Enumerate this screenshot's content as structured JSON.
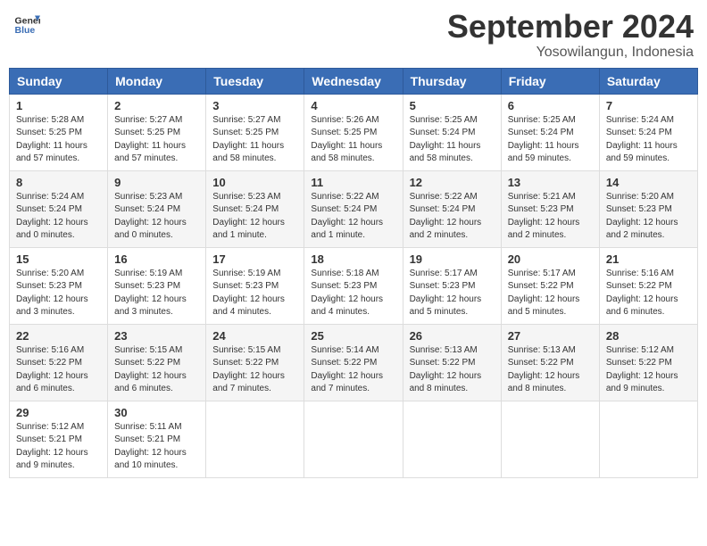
{
  "header": {
    "logo_line1": "General",
    "logo_line2": "Blue",
    "month": "September 2024",
    "location": "Yosowilangun, Indonesia"
  },
  "weekdays": [
    "Sunday",
    "Monday",
    "Tuesday",
    "Wednesday",
    "Thursday",
    "Friday",
    "Saturday"
  ],
  "weeks": [
    [
      {
        "day": "1",
        "info": "Sunrise: 5:28 AM\nSunset: 5:25 PM\nDaylight: 11 hours\nand 57 minutes."
      },
      {
        "day": "2",
        "info": "Sunrise: 5:27 AM\nSunset: 5:25 PM\nDaylight: 11 hours\nand 57 minutes."
      },
      {
        "day": "3",
        "info": "Sunrise: 5:27 AM\nSunset: 5:25 PM\nDaylight: 11 hours\nand 58 minutes."
      },
      {
        "day": "4",
        "info": "Sunrise: 5:26 AM\nSunset: 5:25 PM\nDaylight: 11 hours\nand 58 minutes."
      },
      {
        "day": "5",
        "info": "Sunrise: 5:25 AM\nSunset: 5:24 PM\nDaylight: 11 hours\nand 58 minutes."
      },
      {
        "day": "6",
        "info": "Sunrise: 5:25 AM\nSunset: 5:24 PM\nDaylight: 11 hours\nand 59 minutes."
      },
      {
        "day": "7",
        "info": "Sunrise: 5:24 AM\nSunset: 5:24 PM\nDaylight: 11 hours\nand 59 minutes."
      }
    ],
    [
      {
        "day": "8",
        "info": "Sunrise: 5:24 AM\nSunset: 5:24 PM\nDaylight: 12 hours\nand 0 minutes."
      },
      {
        "day": "9",
        "info": "Sunrise: 5:23 AM\nSunset: 5:24 PM\nDaylight: 12 hours\nand 0 minutes."
      },
      {
        "day": "10",
        "info": "Sunrise: 5:23 AM\nSunset: 5:24 PM\nDaylight: 12 hours\nand 1 minute."
      },
      {
        "day": "11",
        "info": "Sunrise: 5:22 AM\nSunset: 5:24 PM\nDaylight: 12 hours\nand 1 minute."
      },
      {
        "day": "12",
        "info": "Sunrise: 5:22 AM\nSunset: 5:24 PM\nDaylight: 12 hours\nand 2 minutes."
      },
      {
        "day": "13",
        "info": "Sunrise: 5:21 AM\nSunset: 5:23 PM\nDaylight: 12 hours\nand 2 minutes."
      },
      {
        "day": "14",
        "info": "Sunrise: 5:20 AM\nSunset: 5:23 PM\nDaylight: 12 hours\nand 2 minutes."
      }
    ],
    [
      {
        "day": "15",
        "info": "Sunrise: 5:20 AM\nSunset: 5:23 PM\nDaylight: 12 hours\nand 3 minutes."
      },
      {
        "day": "16",
        "info": "Sunrise: 5:19 AM\nSunset: 5:23 PM\nDaylight: 12 hours\nand 3 minutes."
      },
      {
        "day": "17",
        "info": "Sunrise: 5:19 AM\nSunset: 5:23 PM\nDaylight: 12 hours\nand 4 minutes."
      },
      {
        "day": "18",
        "info": "Sunrise: 5:18 AM\nSunset: 5:23 PM\nDaylight: 12 hours\nand 4 minutes."
      },
      {
        "day": "19",
        "info": "Sunrise: 5:17 AM\nSunset: 5:23 PM\nDaylight: 12 hours\nand 5 minutes."
      },
      {
        "day": "20",
        "info": "Sunrise: 5:17 AM\nSunset: 5:22 PM\nDaylight: 12 hours\nand 5 minutes."
      },
      {
        "day": "21",
        "info": "Sunrise: 5:16 AM\nSunset: 5:22 PM\nDaylight: 12 hours\nand 6 minutes."
      }
    ],
    [
      {
        "day": "22",
        "info": "Sunrise: 5:16 AM\nSunset: 5:22 PM\nDaylight: 12 hours\nand 6 minutes."
      },
      {
        "day": "23",
        "info": "Sunrise: 5:15 AM\nSunset: 5:22 PM\nDaylight: 12 hours\nand 6 minutes."
      },
      {
        "day": "24",
        "info": "Sunrise: 5:15 AM\nSunset: 5:22 PM\nDaylight: 12 hours\nand 7 minutes."
      },
      {
        "day": "25",
        "info": "Sunrise: 5:14 AM\nSunset: 5:22 PM\nDaylight: 12 hours\nand 7 minutes."
      },
      {
        "day": "26",
        "info": "Sunrise: 5:13 AM\nSunset: 5:22 PM\nDaylight: 12 hours\nand 8 minutes."
      },
      {
        "day": "27",
        "info": "Sunrise: 5:13 AM\nSunset: 5:22 PM\nDaylight: 12 hours\nand 8 minutes."
      },
      {
        "day": "28",
        "info": "Sunrise: 5:12 AM\nSunset: 5:22 PM\nDaylight: 12 hours\nand 9 minutes."
      }
    ],
    [
      {
        "day": "29",
        "info": "Sunrise: 5:12 AM\nSunset: 5:21 PM\nDaylight: 12 hours\nand 9 minutes."
      },
      {
        "day": "30",
        "info": "Sunrise: 5:11 AM\nSunset: 5:21 PM\nDaylight: 12 hours\nand 10 minutes."
      },
      {
        "day": "",
        "info": ""
      },
      {
        "day": "",
        "info": ""
      },
      {
        "day": "",
        "info": ""
      },
      {
        "day": "",
        "info": ""
      },
      {
        "day": "",
        "info": ""
      }
    ]
  ]
}
